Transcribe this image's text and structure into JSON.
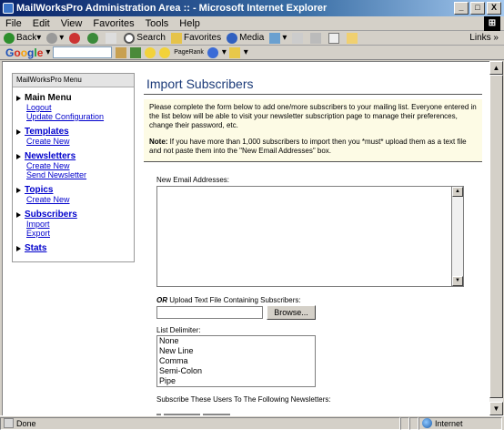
{
  "window": {
    "title": "MailWorksPro Administration Area :: - Microsoft Internet Explorer",
    "controls": [
      "_",
      "□",
      "X"
    ]
  },
  "menubar": [
    "File",
    "Edit",
    "View",
    "Favorites",
    "Tools",
    "Help"
  ],
  "toolbar": {
    "back": "Back",
    "search": "Search",
    "favorites": "Favorites",
    "media": "Media",
    "links": "Links"
  },
  "googlebar": {
    "logo": [
      "G",
      "o",
      "o",
      "g",
      "l",
      "e"
    ],
    "pagerank": "PageRank"
  },
  "sidebar": {
    "heading": "MailWorksPro Menu",
    "groups": [
      {
        "title": "Main Menu",
        "items": [
          "Logout",
          "Update Configuration"
        ]
      },
      {
        "title": "Templates",
        "items": [
          "Create New"
        ]
      },
      {
        "title": "Newsletters",
        "items": [
          "Create New",
          "Send Newsletter"
        ]
      },
      {
        "title": "Topics",
        "items": [
          "Create New"
        ]
      },
      {
        "title": "Subscribers",
        "items": [
          "Import",
          "Export"
        ]
      },
      {
        "title": "Stats",
        "items": []
      }
    ]
  },
  "main": {
    "title": "Import Subscribers",
    "intro": "Please complete the form below to add one/more subscribers to your mailing list. Everyone entered in the list below will be able to visit your newsletter subscription page to manage their preferences, change their password, etc.",
    "note_label": "Note:",
    "note_text": " If you have more than 1,000 subscribers to import then you *must* upload them as a text file and not paste them into the \"New Email Addresses\" box.",
    "email_label": "New Email Addresses:",
    "upload_or": "OR",
    "upload_label": " Upload Text File Containing Subscribers:",
    "browse_label": "Browse...",
    "delimiter_label": "List Delimiter:",
    "delimiters": [
      "None",
      "New Line",
      "Comma",
      "Semi-Colon",
      "Pipe"
    ],
    "subscribe_label": "Subscribe These Users To The Following Newsletters:"
  },
  "statusbar": {
    "status": "Done",
    "zone": "Internet"
  }
}
